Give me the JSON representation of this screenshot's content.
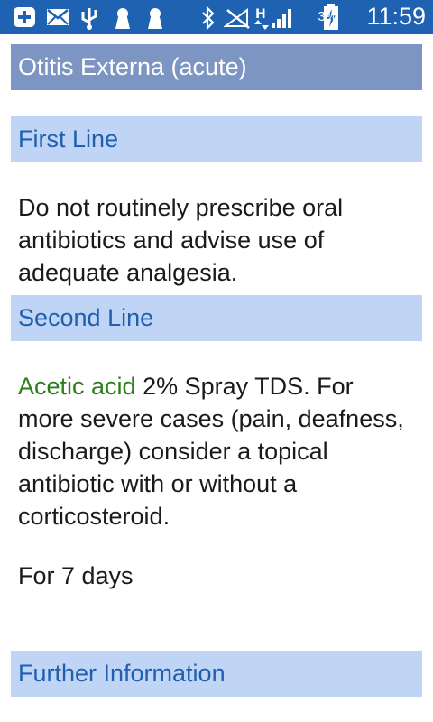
{
  "status_bar": {
    "battery_percent": "3%",
    "time": "11:59",
    "icons": [
      "add-notification-icon",
      "email-icon",
      "usb-icon",
      "keyhole-icon",
      "keyhole-icon",
      "bluetooth-icon",
      "no-sim-signal-icon",
      "hspa-data-icon",
      "signal-strength-icon",
      "battery-charging-icon"
    ]
  },
  "page": {
    "title": "Otitis Externa (acute)"
  },
  "sections": {
    "first_line": {
      "header": "First Line",
      "text": "Do not routinely prescribe oral antibiotics and advise use of adequate analgesia."
    },
    "second_line": {
      "header": "Second Line",
      "drug_name": "Acetic acid",
      "text": " 2% Spray TDS. For more severe cases (pain, deafness, discharge) consider a topical antibiotic with or without a corticosteroid.",
      "duration": "For 7 days"
    },
    "further_information": {
      "header": "Further Information"
    }
  },
  "colors": {
    "status_bar": "#1f62b2",
    "title_bar": "#7d95c2",
    "section_bar": "#c0d4f5",
    "section_text": "#1f5fae",
    "drug_text": "#2e7d1c"
  }
}
